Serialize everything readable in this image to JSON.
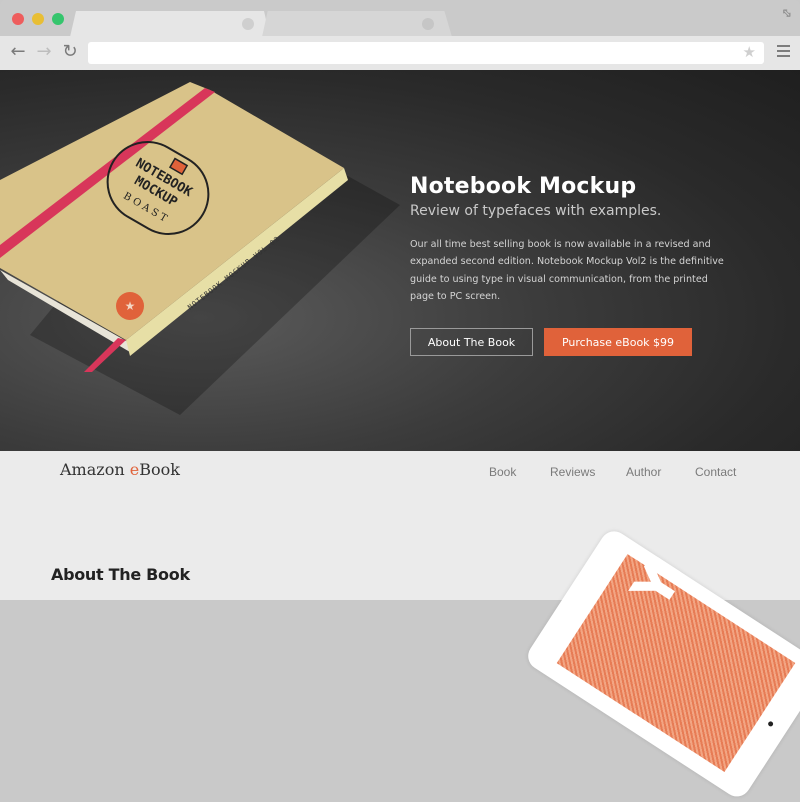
{
  "browser": {
    "tabs": [
      {
        "label": "",
        "active": true
      },
      {
        "label": "",
        "active": false
      }
    ],
    "url": "",
    "icons": {
      "back": "arrow-left-icon",
      "forward": "arrow-right-icon",
      "reload": "reload-icon",
      "bookmark": "star-icon",
      "menu": "hamburger-menu-icon",
      "fullscreen": "expand-icon"
    }
  },
  "hero": {
    "title": "Notebook Mockup",
    "subtitle": "Review of typefaces with examples.",
    "description": "Our all time best selling book is now available in a revised and expanded second edition. Notebook Mockup Vol2 is the definitive guide to using type in visual communication, from the printed page to PC screen.",
    "buttons": {
      "about": "About The Book",
      "purchase": "Purchase eBook $99"
    },
    "notebook": {
      "cover_line1": "NOTEBOOK",
      "cover_line2": "MOCKUP",
      "cover_brand": "BOAST",
      "spine_text": "NOTEBOOK MOCKUP VOL.02"
    }
  },
  "navbar": {
    "brand_prefix": "Amazon ",
    "brand_accent": "e",
    "brand_suffix": "Book",
    "links": [
      "Book",
      "Reviews",
      "Author",
      "Contact"
    ]
  },
  "section": {
    "title": "About The Book",
    "tablet_text": "YO"
  },
  "colors": {
    "accent": "#e0623a",
    "hero_bg": "#2a2a2a",
    "page_bg": "#ebebeb",
    "elastic_band": "#d8365a",
    "cover": "#d9c389"
  }
}
